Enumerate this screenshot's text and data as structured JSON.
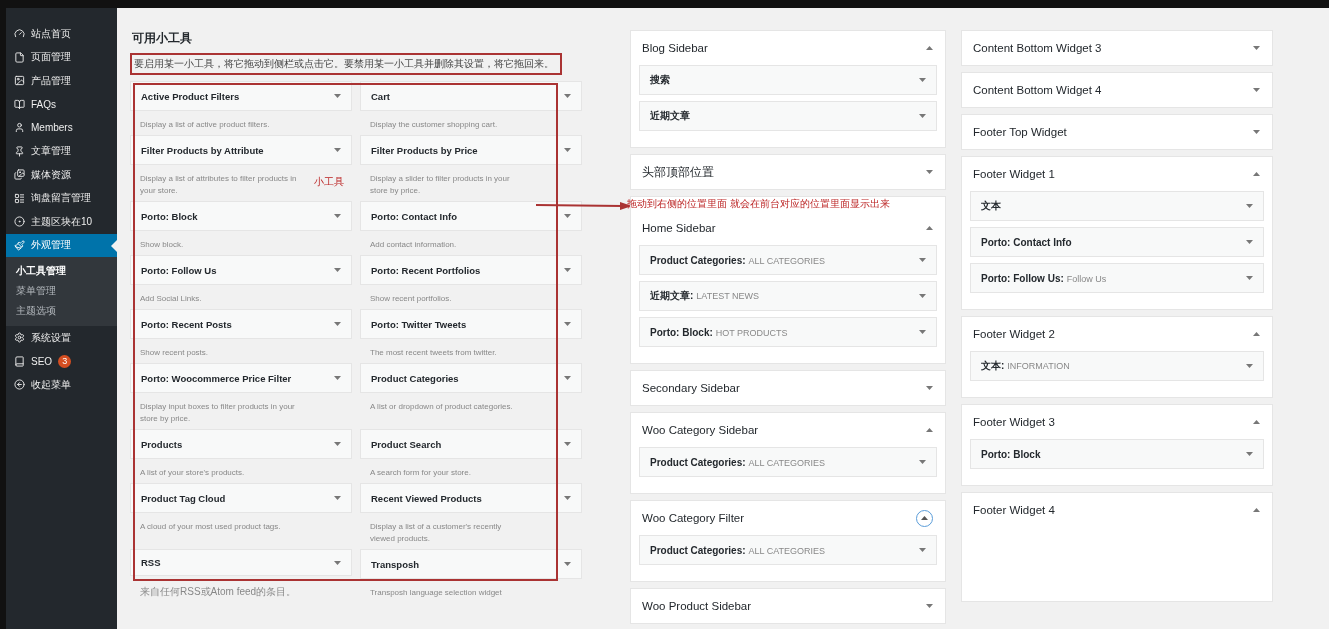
{
  "sidebar": {
    "items": [
      {
        "label": "站点首页",
        "selected": false
      },
      {
        "label": "页面管理",
        "selected": false
      },
      {
        "label": "产品管理",
        "selected": false
      },
      {
        "label": "FAQs",
        "selected": false
      },
      {
        "label": "Members",
        "selected": false
      },
      {
        "label": "文章管理",
        "selected": false
      },
      {
        "label": "媒体资源",
        "selected": false
      },
      {
        "label": "询盘留言管理",
        "selected": false
      },
      {
        "label": "主题区块在10",
        "selected": false
      },
      {
        "label": "外观管理",
        "selected": true,
        "children": [
          {
            "label": "小工具管理",
            "selected": true
          },
          {
            "label": "菜单管理",
            "selected": false
          },
          {
            "label": "主题选项",
            "selected": false
          }
        ]
      },
      {
        "label": "系统设置",
        "selected": false
      },
      {
        "label": "SEO",
        "selected": false,
        "badge": "3"
      },
      {
        "label": "收起菜单",
        "selected": false
      }
    ]
  },
  "available": {
    "title": "可用小工具",
    "description": "要启用某一小工具，将它拖动到侧栏或点击它。要禁用某一小工具并删除其设置，将它拖回来。",
    "widgets": [
      {
        "title": "Active Product Filters",
        "description": "Display a list of active product filters."
      },
      {
        "title": "Cart",
        "description": "Display the customer shopping cart."
      },
      {
        "title": "Filter Products by Attribute",
        "description": "Display a list of attributes to filter products in your store."
      },
      {
        "title": "Filter Products by Price",
        "description": "Display a slider to filter products in your store by price."
      },
      {
        "title": "Porto: Block",
        "description": "Show block."
      },
      {
        "title": "Porto: Contact Info",
        "description": "Add contact information."
      },
      {
        "title": "Porto: Follow Us",
        "description": "Add Social Links."
      },
      {
        "title": "Porto: Recent Portfolios",
        "description": "Show recent portfolios."
      },
      {
        "title": "Porto: Recent Posts",
        "description": "Show recent posts."
      },
      {
        "title": "Porto: Twitter Tweets",
        "description": "The most recent tweets from twitter."
      },
      {
        "title": "Porto: Woocommerce Price Filter",
        "description": "Display input boxes to filter products in your store by price."
      },
      {
        "title": "Product Categories",
        "description": "A list or dropdown of product categories."
      },
      {
        "title": "Products",
        "description": "A list of your store's products."
      },
      {
        "title": "Product Search",
        "description": "A search form for your store."
      },
      {
        "title": "Product Tag Cloud",
        "description": "A cloud of your most used product tags."
      },
      {
        "title": "Recent Viewed Products",
        "description": "Display a list of a customer's recently viewed products."
      },
      {
        "title": "RSS",
        "description": "来自任何RSS或Atom feed的条目。"
      },
      {
        "title": "Transposh",
        "description": "Transposh language selection widget"
      }
    ]
  },
  "areas": [
    [
      {
        "title": "Blog Sidebar",
        "expanded": true,
        "focused": false,
        "widgets": [
          {
            "name": "搜索"
          },
          {
            "name": "近期文章"
          }
        ]
      },
      {
        "title": "头部顶部位置",
        "expanded": false,
        "focused": false
      },
      {
        "title": "Home Sidebar",
        "expanded": true,
        "focused": false,
        "widgets": [
          {
            "name": "Product Categories:",
            "detail": "ALL CATEGORIES"
          },
          {
            "name": "近期文章:",
            "detail": "LATEST NEWS"
          },
          {
            "name": "Porto: Block:",
            "detail": "HOT PRODUCTS"
          }
        ]
      },
      {
        "title": "Secondary Sidebar",
        "expanded": false,
        "focused": false
      },
      {
        "title": "Woo Category Sidebar",
        "expanded": true,
        "focused": false,
        "widgets": [
          {
            "name": "Product Categories:",
            "detail": "ALL CATEGORIES"
          }
        ]
      },
      {
        "title": "Woo Category Filter",
        "expanded": true,
        "focused": true,
        "widgets": [
          {
            "name": "Product Categories:",
            "detail": "ALL CATEGORIES"
          }
        ]
      },
      {
        "title": "Woo Product Sidebar",
        "expanded": false,
        "focused": false
      }
    ],
    [
      {
        "title": "Content Bottom Widget 3",
        "expanded": false,
        "focused": false
      },
      {
        "title": "Content Bottom Widget 4",
        "expanded": false,
        "focused": false
      },
      {
        "title": "Footer Top Widget",
        "expanded": false,
        "focused": false
      },
      {
        "title": "Footer Widget 1",
        "expanded": true,
        "focused": false,
        "widgets": [
          {
            "name": "文本"
          },
          {
            "name": "Porto: Contact Info"
          },
          {
            "name": "Porto: Follow Us:",
            "detail": "Follow Us"
          }
        ]
      },
      {
        "title": "Footer Widget 2",
        "expanded": true,
        "focused": false,
        "widgets": [
          {
            "name": "文本:",
            "detail": "INFORMATION"
          }
        ]
      },
      {
        "title": "Footer Widget 3",
        "expanded": true,
        "focused": false,
        "widgets": [
          {
            "name": "Porto: Block"
          }
        ]
      },
      {
        "title": "Footer Widget 4",
        "expanded": true,
        "focused": false
      }
    ]
  ],
  "annotations": {
    "widgets_label": "小工具",
    "drag_hint": "拖动到右侧的位置里面 就会在前台对应的位置里面显示出来"
  }
}
